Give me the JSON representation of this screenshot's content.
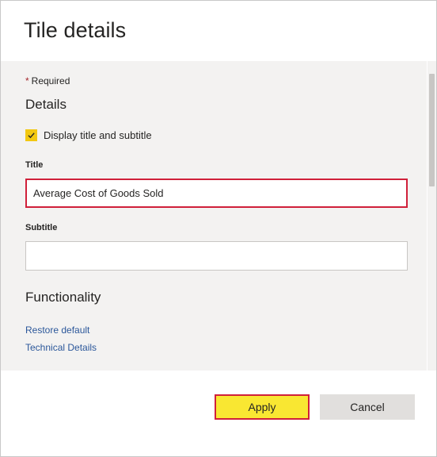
{
  "dialog": {
    "title": "Tile details",
    "required_marker": "*",
    "required_label": "Required"
  },
  "details": {
    "heading": "Details",
    "display_checkbox": {
      "label": "Display title and subtitle",
      "checked": true
    },
    "title_field": {
      "label": "Title",
      "value": "Average Cost of Goods Sold"
    },
    "subtitle_field": {
      "label": "Subtitle",
      "value": ""
    }
  },
  "functionality": {
    "heading": "Functionality",
    "links": [
      "Restore default",
      "Technical Details"
    ]
  },
  "buttons": {
    "apply": "Apply",
    "cancel": "Cancel"
  },
  "colors": {
    "accent_yellow": "#f2c811",
    "apply_fill": "#f9e732",
    "highlight_red": "#d0203a",
    "link_blue": "#2b579a"
  }
}
